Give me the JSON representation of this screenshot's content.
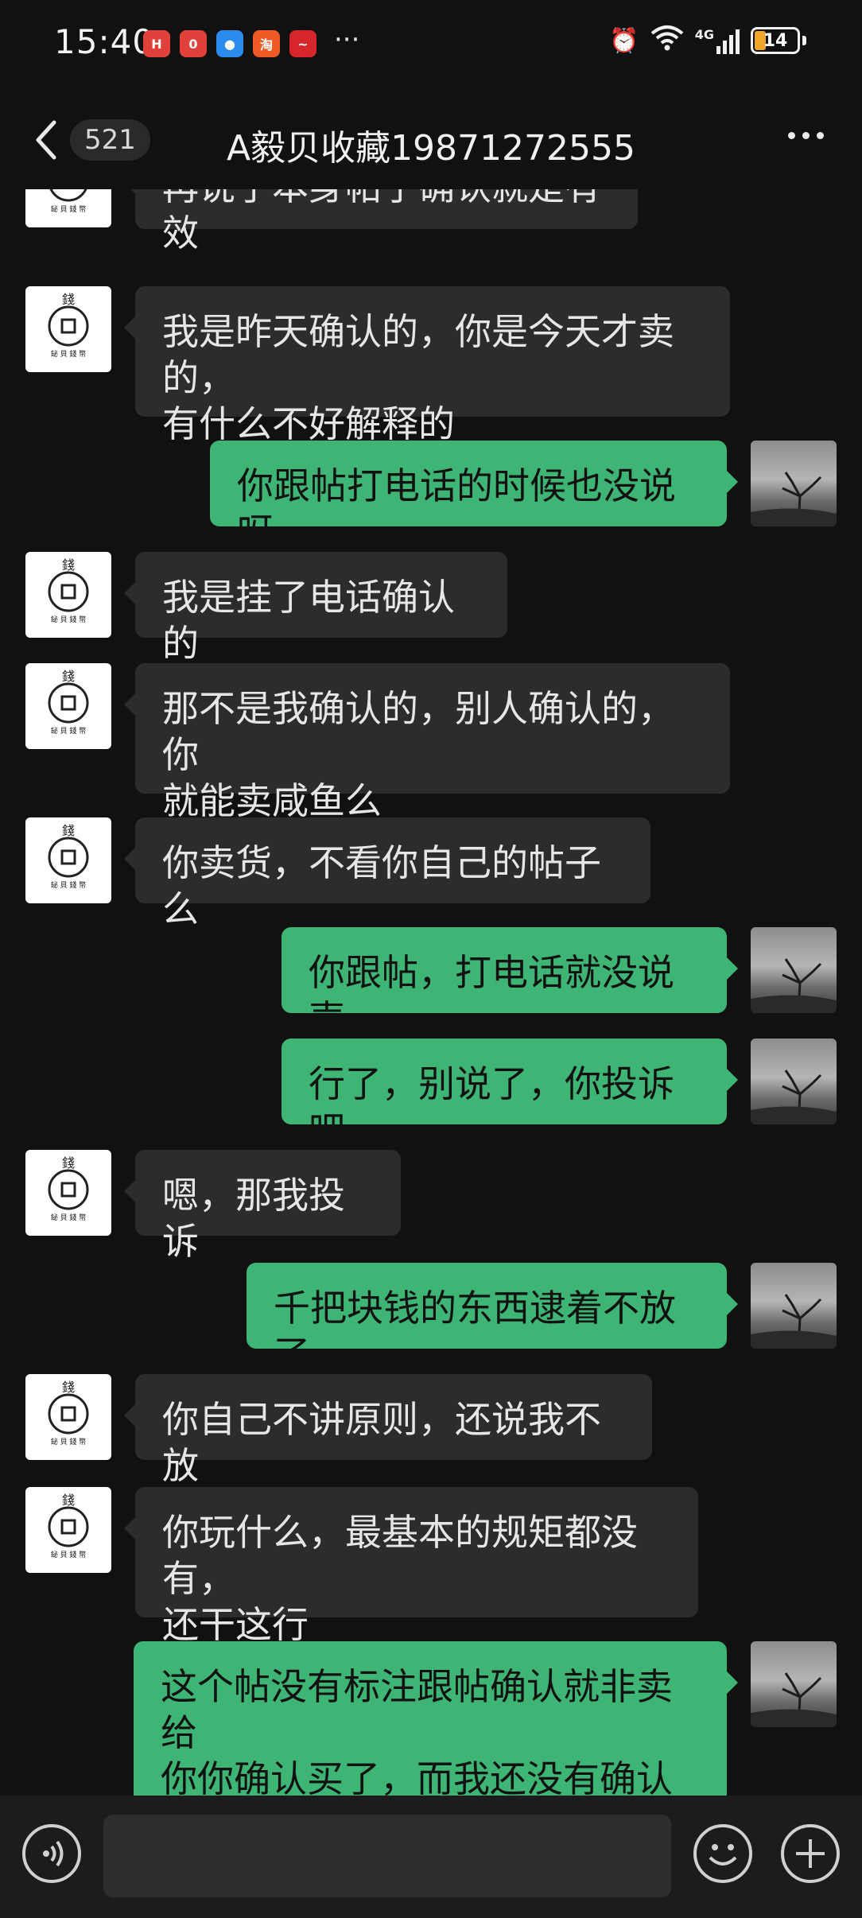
{
  "status": {
    "time": "15:40",
    "notifications": [
      {
        "icon": "huawei-app-icon",
        "color": "#e0413a",
        "glyph": "H"
      },
      {
        "icon": "red-app-icon",
        "color": "#e0413a",
        "glyph": "0"
      },
      {
        "icon": "message-app-icon",
        "color": "#2b8cf0",
        "glyph": "●"
      },
      {
        "icon": "taobao-icon",
        "color": "#f05a24",
        "glyph": "淘"
      },
      {
        "icon": "stock-app-icon",
        "color": "#d6262a",
        "glyph": "~"
      }
    ],
    "more": "···",
    "network": "4G",
    "battery": "14"
  },
  "nav": {
    "unread_count": "521",
    "title": "A毅贝收藏19871272555"
  },
  "messages": [
    {
      "side": "in",
      "text": "再说了本身帖子确认就是有效"
    },
    {
      "side": "in",
      "text": "我是昨天确认的，你是今天才卖的，\n有什么不好解释的"
    },
    {
      "side": "out",
      "text": "你跟帖打电话的时候也没说呀"
    },
    {
      "side": "in",
      "text": "我是挂了电话确认的"
    },
    {
      "side": "in",
      "text": "那不是我确认的，别人确认的，你\n就能卖咸鱼么"
    },
    {
      "side": "in",
      "text": "你卖货，不看你自己的帖子么"
    },
    {
      "side": "out",
      "text": "你跟帖，打电话就没说声"
    },
    {
      "side": "out",
      "text": "行了，别说了，你投诉吧"
    },
    {
      "side": "in",
      "text": "嗯，那我投诉"
    },
    {
      "side": "out",
      "text": "千把块钱的东西逮着不放了"
    },
    {
      "side": "in",
      "text": "你自己不讲原则，还说我不放"
    },
    {
      "side": "in",
      "text": "你玩什么，最基本的规矩都没有，\n还干这行"
    },
    {
      "side": "out",
      "text": "这个帖没有标注跟帖确认就非卖给\n你你确认买了，而我还没有确认卖\n给你，"
    }
  ],
  "avatar_caption": "YiBei Coin",
  "input": {
    "value": ""
  },
  "colors": {
    "outgoing": "#3eb574",
    "incoming": "#2c2c2c",
    "background": "#111111"
  }
}
